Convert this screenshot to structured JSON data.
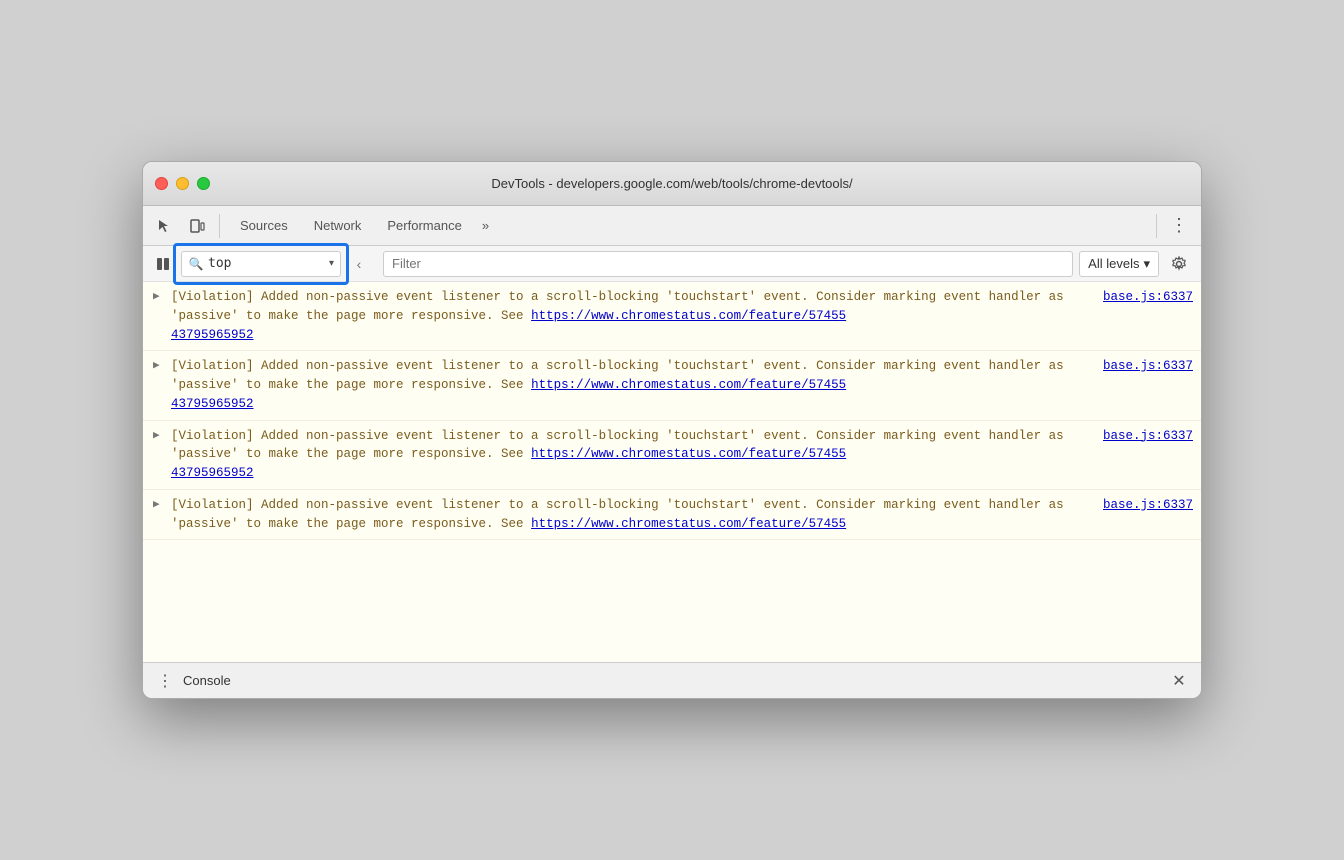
{
  "window": {
    "title": "DevTools - developers.google.com/web/tools/chrome-devtools/"
  },
  "titlebar": {
    "traffic_lights": [
      "close",
      "minimize",
      "maximize"
    ]
  },
  "devtools_toolbar": {
    "tabs": [
      "Sources",
      "Network",
      "Performance"
    ],
    "more_label": "»",
    "menu_icon": "⋮"
  },
  "console_toolbar": {
    "context_selector_value": "top",
    "filter_placeholder": "Filter",
    "levels_label": "All levels",
    "levels_arrow": "▾"
  },
  "console_entries": [
    {
      "text": "[Violation] Added non-passive event listener to a scroll-blocking 'touchstart' event. Consider marking event handler as 'passive' to make the page more responsive. See ",
      "url": "https://www.chromestatus.com/feature/5745543795965952",
      "source": "base.js:6337"
    },
    {
      "text": "[Violation] Added non-passive event listener to a scroll-blocking 'touchstart' event. Consider marking event handler as 'passive' to make the page more responsive. See ",
      "url": "https://www.chromestatus.com/feature/5745543795965952",
      "source": "base.js:6337"
    },
    {
      "text": "[Violation] Added non-passive event listener to a scroll-blocking 'touchstart' event. Consider marking event handler as 'passive' to make the page more responsive. See ",
      "url": "https://www.chromestatus.com/feature/5745543795965952",
      "source": "base.js:6337"
    },
    {
      "text": "[Violation] Added non-passive event listener to a scroll-blocking 'touchstart' event. Consider marking event handler as 'passive' to make the page more responsive. See ",
      "url": "https://www.chromestatus.com/feature/57455",
      "source": "base.js:6337",
      "partial": true
    }
  ],
  "bottombar": {
    "title": "Console",
    "menu_icon": "⋮",
    "close_icon": "✕"
  },
  "colors": {
    "highlight_blue": "#1a73e8",
    "warning_bg": "#fffef2",
    "warning_text": "#7a5c1e",
    "link_color": "#0000cc"
  }
}
